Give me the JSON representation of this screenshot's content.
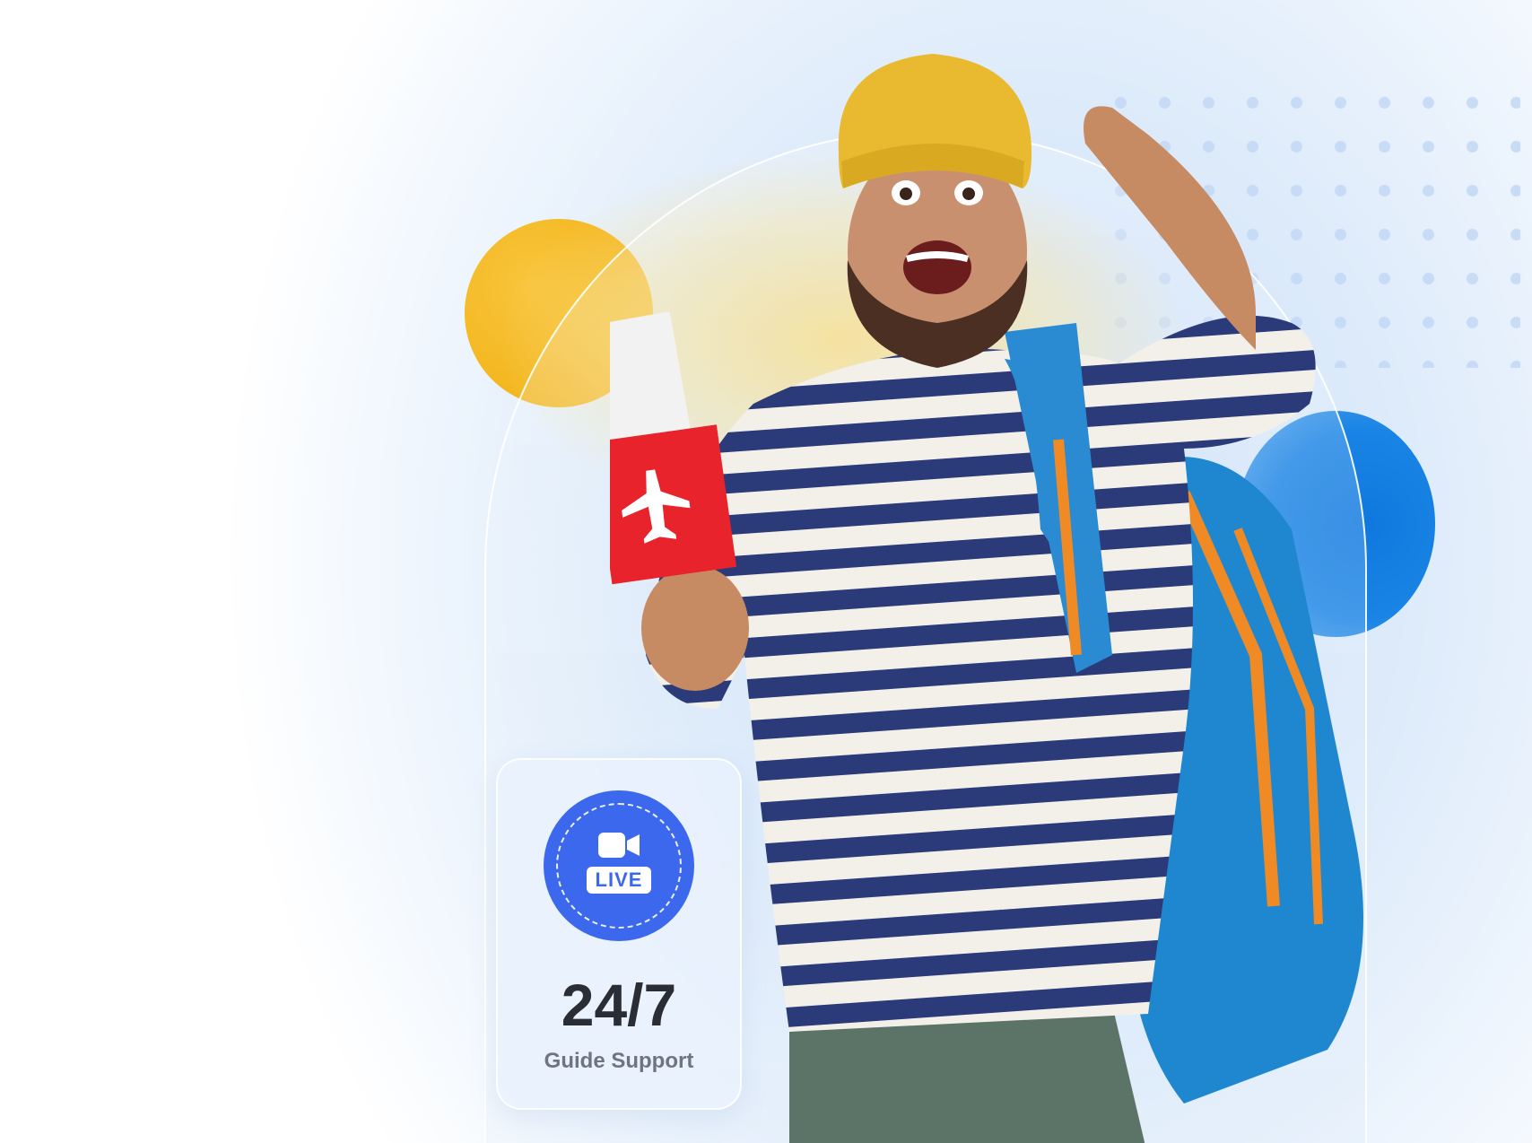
{
  "support_card": {
    "badge_label": "LIVE",
    "badge_icon": "video-camera-icon",
    "number": "24/7",
    "caption": "Guide Support"
  },
  "colors": {
    "accent_blue": "#3b68ec",
    "yellow": "#f4b823",
    "deep_blue": "#0f78de",
    "passport_red": "#e8232b",
    "text_dark": "#2a2d33",
    "text_muted": "#6f7580"
  }
}
